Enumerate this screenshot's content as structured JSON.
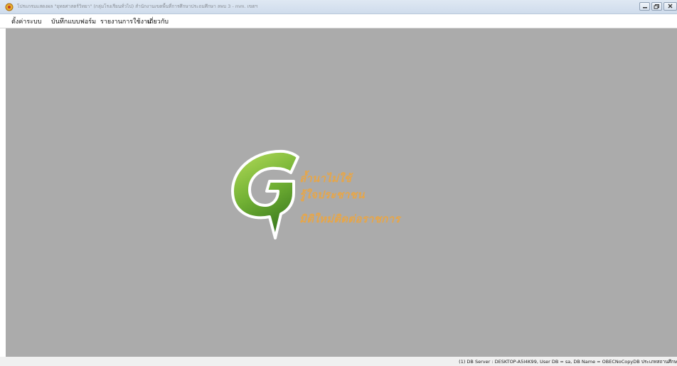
{
  "window": {
    "title": "โปรแกรมแสดงผล \"ยุทธศาสตร์วิทยา\" (กลุ่มโรงเรียนทั่วไป) สำนักงานเขตพื้นที่การศึกษาประถมศึกษา ลพบ 3 - mm. เขตฯ",
    "controls": [
      "minimize",
      "restore",
      "close"
    ]
  },
  "menu": {
    "items": [
      "ตั้งค่าระบบ",
      "บันทึกแบบฟอร์ม",
      "รายงานการใช้งาน",
      "เกี่ยวกับ"
    ]
  },
  "logo": {
    "letter_icon": "g-logo-icon",
    "colors": {
      "green_light": "#b6dd5a",
      "green_dark": "#3e7d1f",
      "slogan": "#e6a64a"
    },
    "slogan_lines": [
      "ล้ำนาไม่ใช้",
      "รู้ใจประชาชน",
      "มิติใหม่ติดต่อราชการ"
    ]
  },
  "workspace": {
    "background": "#ababab"
  },
  "status": {
    "text": "(1) DB Server : DESKTOP-A5I4K99, User DB = sa, DB Name = OBECNoCopyDB ประเภทสถานศึกษ"
  }
}
